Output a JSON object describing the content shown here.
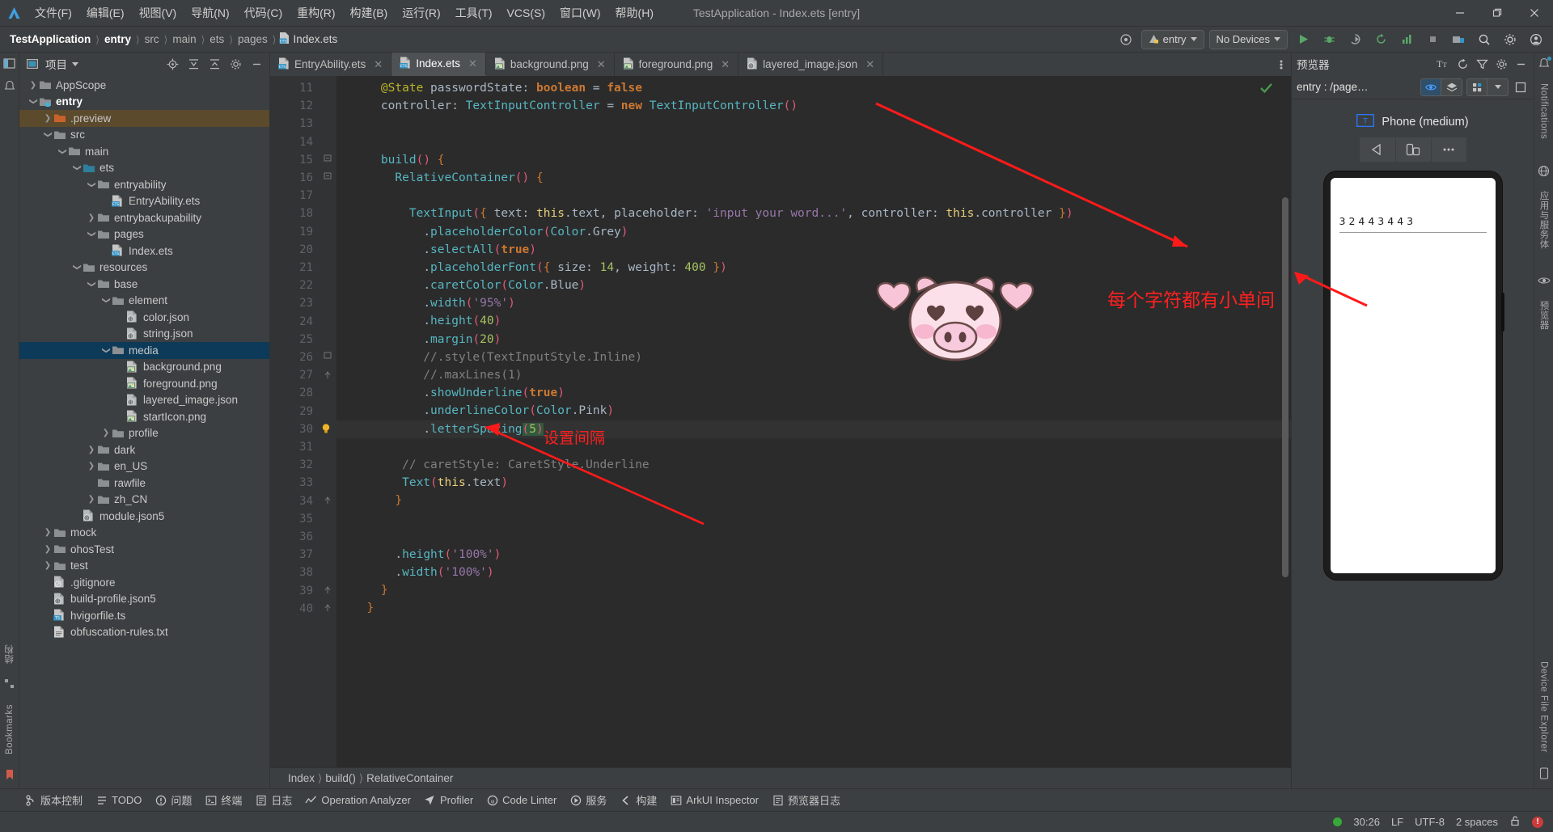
{
  "titlebar": {
    "logo_icon": "devecostudio-logo-icon",
    "menus": [
      {
        "label": "文件(F)"
      },
      {
        "label": "编辑(E)"
      },
      {
        "label": "视图(V)"
      },
      {
        "label": "导航(N)"
      },
      {
        "label": "代码(C)"
      },
      {
        "label": "重构(R)"
      },
      {
        "label": "构建(B)"
      },
      {
        "label": "运行(R)"
      },
      {
        "label": "工具(T)"
      },
      {
        "label": "VCS(S)"
      },
      {
        "label": "窗口(W)"
      },
      {
        "label": "帮助(H)"
      }
    ],
    "window_title": "TestApplication - Index.ets [entry]",
    "minimize_label": "—",
    "maximize_label": "❐",
    "close_label": "✕"
  },
  "navbar": {
    "crumbs": [
      "TestApplication",
      "entry",
      "src",
      "main",
      "ets",
      "pages"
    ],
    "file_crumb": "Index.ets",
    "run_config": "entry",
    "device_select": "No Devices",
    "icons": [
      "target-icon",
      "run-icon",
      "debug-icon",
      "coverage-icon",
      "rerun-icon",
      "profile-icon",
      "stop-icon",
      "device-manager-icon",
      "search-icon",
      "settings-icon",
      "account-icon"
    ]
  },
  "left_strip": {
    "items": [
      {
        "label": "项目",
        "icon": "project-icon"
      },
      {
        "label": "结构",
        "icon": "structure-icon"
      },
      {
        "label": "Bookmarks",
        "icon": "bookmark-icon"
      }
    ]
  },
  "project_panel": {
    "title": "项目",
    "header_icons": [
      "locate-icon",
      "expand-all-icon",
      "collapse-all-icon",
      "gear-icon",
      "hide-icon"
    ],
    "tree": [
      {
        "indent": 1,
        "arrow": "collapsed",
        "icon": "folder",
        "label": "AppScope",
        "state": "none"
      },
      {
        "indent": 1,
        "arrow": "expanded",
        "icon": "module",
        "label": "entry",
        "state": "none",
        "bold": true
      },
      {
        "indent": 2,
        "arrow": "collapsed",
        "icon": "folder-orange",
        "label": ".preview",
        "state": "sel-dim"
      },
      {
        "indent": 2,
        "arrow": "expanded",
        "icon": "folder",
        "label": "src",
        "state": "none"
      },
      {
        "indent": 3,
        "arrow": "expanded",
        "icon": "folder",
        "label": "main",
        "state": "none"
      },
      {
        "indent": 4,
        "arrow": "expanded",
        "icon": "folder-teal",
        "label": "ets",
        "state": "none"
      },
      {
        "indent": 5,
        "arrow": "expanded",
        "icon": "folder",
        "label": "entryability",
        "state": "none"
      },
      {
        "indent": 6,
        "arrow": "none",
        "icon": "ets-file",
        "label": "EntryAbility.ets",
        "state": "none"
      },
      {
        "indent": 5,
        "arrow": "collapsed",
        "icon": "folder",
        "label": "entrybackupability",
        "state": "none"
      },
      {
        "indent": 5,
        "arrow": "expanded",
        "icon": "folder",
        "label": "pages",
        "state": "none"
      },
      {
        "indent": 6,
        "arrow": "none",
        "icon": "ets-file",
        "label": "Index.ets",
        "state": "none"
      },
      {
        "indent": 4,
        "arrow": "expanded",
        "icon": "folder",
        "label": "resources",
        "state": "none"
      },
      {
        "indent": 5,
        "arrow": "expanded",
        "icon": "folder",
        "label": "base",
        "state": "none"
      },
      {
        "indent": 6,
        "arrow": "expanded",
        "icon": "folder",
        "label": "element",
        "state": "none"
      },
      {
        "indent": 7,
        "arrow": "none",
        "icon": "json-file",
        "label": "color.json",
        "state": "none"
      },
      {
        "indent": 7,
        "arrow": "none",
        "icon": "json-file",
        "label": "string.json",
        "state": "none"
      },
      {
        "indent": 6,
        "arrow": "expanded",
        "icon": "folder",
        "label": "media",
        "state": "sel-blue"
      },
      {
        "indent": 7,
        "arrow": "none",
        "icon": "image-file",
        "label": "background.png",
        "state": "none"
      },
      {
        "indent": 7,
        "arrow": "none",
        "icon": "image-file",
        "label": "foreground.png",
        "state": "none"
      },
      {
        "indent": 7,
        "arrow": "none",
        "icon": "json-file",
        "label": "layered_image.json",
        "state": "none"
      },
      {
        "indent": 7,
        "arrow": "none",
        "icon": "image-file",
        "label": "startIcon.png",
        "state": "none"
      },
      {
        "indent": 6,
        "arrow": "collapsed",
        "icon": "folder",
        "label": "profile",
        "state": "none"
      },
      {
        "indent": 5,
        "arrow": "collapsed",
        "icon": "folder",
        "label": "dark",
        "state": "none"
      },
      {
        "indent": 5,
        "arrow": "collapsed",
        "icon": "folder",
        "label": "en_US",
        "state": "none"
      },
      {
        "indent": 5,
        "arrow": "none",
        "icon": "folder",
        "label": "rawfile",
        "state": "none"
      },
      {
        "indent": 5,
        "arrow": "collapsed",
        "icon": "folder",
        "label": "zh_CN",
        "state": "none"
      },
      {
        "indent": 4,
        "arrow": "none",
        "icon": "json-file",
        "label": "module.json5",
        "state": "none"
      },
      {
        "indent": 2,
        "arrow": "collapsed",
        "icon": "folder",
        "label": "mock",
        "state": "none"
      },
      {
        "indent": 2,
        "arrow": "collapsed",
        "icon": "folder",
        "label": "ohosTest",
        "state": "none"
      },
      {
        "indent": 2,
        "arrow": "collapsed",
        "icon": "folder",
        "label": "test",
        "state": "none"
      },
      {
        "indent": 2,
        "arrow": "none",
        "icon": "gitignore-file",
        "label": ".gitignore",
        "state": "none"
      },
      {
        "indent": 2,
        "arrow": "none",
        "icon": "json-file",
        "label": "build-profile.json5",
        "state": "none"
      },
      {
        "indent": 2,
        "arrow": "none",
        "icon": "ts-file",
        "label": "hvigorfile.ts",
        "state": "none"
      },
      {
        "indent": 2,
        "arrow": "none",
        "icon": "txt-file",
        "label": "obfuscation-rules.txt",
        "state": "none"
      }
    ]
  },
  "editor": {
    "tabs": [
      {
        "label": "EntryAbility.ets",
        "icon": "ets-file",
        "active": false
      },
      {
        "label": "Index.ets",
        "icon": "ets-file",
        "active": true
      },
      {
        "label": "background.png",
        "icon": "image-file",
        "active": false
      },
      {
        "label": "foreground.png",
        "icon": "image-file",
        "active": false
      },
      {
        "label": "layered_image.json",
        "icon": "json-file",
        "active": false
      }
    ],
    "more_icon": "more-vertical-icon",
    "inspection_status_icon": "check-ok-icon",
    "first_line_number": 11,
    "last_line_number": 40,
    "highlight_line": 30,
    "lines": [
      {
        "n": 11,
        "text": "    @State passwordState: boolean = false"
      },
      {
        "n": 12,
        "text": "    controller: TextInputController = new TextInputController()"
      },
      {
        "n": 13,
        "text": ""
      },
      {
        "n": 14,
        "text": ""
      },
      {
        "n": 15,
        "text": "    build() {"
      },
      {
        "n": 16,
        "text": "      RelativeContainer() {"
      },
      {
        "n": 17,
        "text": ""
      },
      {
        "n": 18,
        "text": "        TextInput({ text: this.text, placeholder: 'input your word...', controller: this.controller })"
      },
      {
        "n": 19,
        "text": "          .placeholderColor(Color.Grey)"
      },
      {
        "n": 20,
        "text": "          .selectAll(true)"
      },
      {
        "n": 21,
        "text": "          .placeholderFont({ size: 14, weight: 400 })"
      },
      {
        "n": 22,
        "text": "          .caretColor(Color.Blue)"
      },
      {
        "n": 23,
        "text": "          .width('95%')"
      },
      {
        "n": 24,
        "text": "          .height(40)"
      },
      {
        "n": 25,
        "text": "          .margin(20)"
      },
      {
        "n": 26,
        "text": "          //.style(TextInputStyle.Inline)"
      },
      {
        "n": 27,
        "text": "          //.maxLines(1)"
      },
      {
        "n": 28,
        "text": "          .showUnderline(true)"
      },
      {
        "n": 29,
        "text": "          .underlineColor(Color.Pink)"
      },
      {
        "n": 30,
        "text": "          .letterSpacing(5)"
      },
      {
        "n": 31,
        "text": ""
      },
      {
        "n": 32,
        "text": "       // caretStyle: CaretStyle.Underline"
      },
      {
        "n": 33,
        "text": "       Text(this.text)"
      },
      {
        "n": 34,
        "text": "      }"
      },
      {
        "n": 35,
        "text": ""
      },
      {
        "n": 36,
        "text": ""
      },
      {
        "n": 37,
        "text": "      .height('100%')"
      },
      {
        "n": 38,
        "text": "      .width('100%')"
      },
      {
        "n": 39,
        "text": "    }"
      },
      {
        "n": 40,
        "text": "  }"
      }
    ],
    "breadcrumbs": [
      "Index",
      "build()",
      "RelativeContainer"
    ]
  },
  "preview": {
    "title": "预览器",
    "header_icons": [
      "font-size-icon",
      "refresh-icon",
      "filter-icon",
      "gear-icon",
      "hide-icon"
    ],
    "route": "entry : /page…",
    "toolbar_icons": [
      "inspector-icon",
      "layers-icon",
      "multi-device-icon",
      "chevron-down-icon",
      "frame-icon"
    ],
    "device_name": "Phone (medium)",
    "device_icon": "text-badge-icon",
    "controls": [
      "rotate-icon",
      "fold-icon",
      "more-icon"
    ],
    "screen_text": "32443443"
  },
  "annotations": [
    {
      "id": "anno-letter-spacing",
      "text": "设置间隔"
    },
    {
      "id": "anno-per-char-gap",
      "text": "每个字符都有小单间"
    }
  ],
  "right_strip": {
    "items": [
      {
        "label": "Notifications",
        "icon": "bell-icon"
      },
      {
        "label": "应用与服务体",
        "icon": "services-icon"
      },
      {
        "label": "预览器",
        "icon": "eye-icon"
      },
      {
        "label": "Device File Explorer",
        "icon": "device-file-icon"
      }
    ]
  },
  "bottom_bar": {
    "items": [
      {
        "label": "版本控制",
        "icon": "vcs-icon"
      },
      {
        "label": "TODO",
        "icon": "todo-icon"
      },
      {
        "label": "问题",
        "icon": "problems-icon"
      },
      {
        "label": "终端",
        "icon": "terminal-icon"
      },
      {
        "label": "日志",
        "icon": "log-icon"
      },
      {
        "label": "Operation Analyzer",
        "icon": "analyzer-icon"
      },
      {
        "label": "Profiler",
        "icon": "profiler-icon"
      },
      {
        "label": "Code Linter",
        "icon": "linter-icon"
      },
      {
        "label": "服务",
        "icon": "services-icon"
      },
      {
        "label": "构建",
        "icon": "build-icon"
      },
      {
        "label": "ArkUI Inspector",
        "icon": "inspector-icon"
      },
      {
        "label": "预览器日志",
        "icon": "preview-log-icon"
      }
    ]
  },
  "status_bar": {
    "caret_position": "30:26",
    "line_separator": "LF",
    "encoding": "UTF-8",
    "indent": "2 spaces",
    "lock_icon": "unlock-icon",
    "error_icon": "error-icon",
    "status_dot_color": "#37a838"
  },
  "colors": {
    "accent_blue": "#3592c4",
    "annotation_red": "#ff2020",
    "editor_bg": "#2b2b2b",
    "panel_bg": "#3c3f41"
  }
}
